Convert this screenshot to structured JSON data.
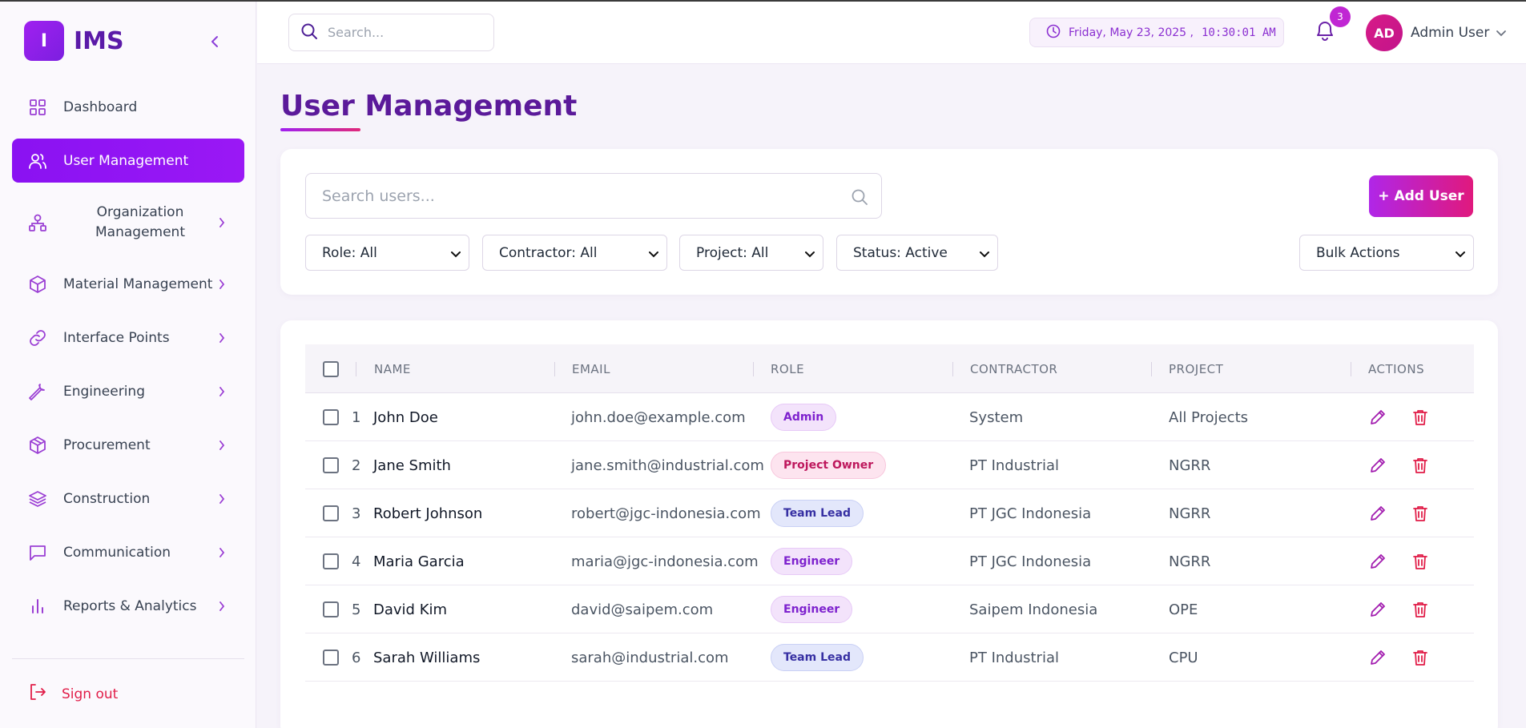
{
  "app": {
    "logo_letter": "I",
    "logo_text": "IMS"
  },
  "sidebar": {
    "items": [
      {
        "label": "Dashboard",
        "icon": "grid-icon",
        "active": false,
        "has_chevron": false
      },
      {
        "label": "User Management",
        "icon": "users-icon",
        "active": true,
        "has_chevron": false
      },
      {
        "label": "Organization Management",
        "icon": "org-chart-icon",
        "active": false,
        "has_chevron": true
      },
      {
        "label": "Material Management",
        "icon": "box-icon",
        "active": false,
        "has_chevron": true
      },
      {
        "label": "Interface Points",
        "icon": "link-icon",
        "active": false,
        "has_chevron": true
      },
      {
        "label": "Engineering",
        "icon": "wrench-icon",
        "active": false,
        "has_chevron": true
      },
      {
        "label": "Procurement",
        "icon": "package-icon",
        "active": false,
        "has_chevron": true
      },
      {
        "label": "Construction",
        "icon": "layers-icon",
        "active": false,
        "has_chevron": true
      },
      {
        "label": "Communication",
        "icon": "chat-icon",
        "active": false,
        "has_chevron": true
      },
      {
        "label": "Reports & Analytics",
        "icon": "bar-chart-icon",
        "active": false,
        "has_chevron": true
      }
    ],
    "signout_label": "Sign out"
  },
  "header": {
    "search_placeholder": "Search...",
    "date": "Friday, May 23, 2025 ,",
    "time": "10:30:01 AM",
    "notification_count": "3",
    "avatar_initials": "AD",
    "user_name": "Admin User"
  },
  "main": {
    "title": "User Management",
    "search_placeholder": "Search users...",
    "add_button_label": "+ Add User",
    "filters": {
      "role": "Role: All",
      "contractor": "Contractor: All",
      "project": "Project: All",
      "status": "Status: Active",
      "bulk": "Bulk Actions"
    }
  },
  "table": {
    "headers": {
      "name": "NAME",
      "email": "EMAIL",
      "role": "ROLE",
      "contractor": "CONTRACTOR",
      "project": "PROJECT",
      "actions": "ACTIONS"
    },
    "rows": [
      {
        "no": "1",
        "name": "John Doe",
        "email": "john.doe@example.com",
        "role": "Admin",
        "contractor": "System",
        "project": "All Projects"
      },
      {
        "no": "2",
        "name": "Jane Smith",
        "email": "jane.smith@industrial.com",
        "role": "Project Owner",
        "contractor": "PT Industrial",
        "project": "NGRR"
      },
      {
        "no": "3",
        "name": "Robert Johnson",
        "email": "robert@jgc-indonesia.com",
        "role": "Team Lead",
        "contractor": "PT JGC Indonesia",
        "project": "NGRR"
      },
      {
        "no": "4",
        "name": "Maria Garcia",
        "email": "maria@jgc-indonesia.com",
        "role": "Engineer",
        "contractor": "PT JGC Indonesia",
        "project": "NGRR"
      },
      {
        "no": "5",
        "name": "David Kim",
        "email": "david@saipem.com",
        "role": "Engineer",
        "contractor": "Saipem Indonesia",
        "project": "OPE"
      },
      {
        "no": "6",
        "name": "Sarah Williams",
        "email": "sarah@industrial.com",
        "role": "Team Lead",
        "contractor": "PT Industrial",
        "project": "CPU"
      }
    ]
  },
  "colors": {
    "accent": "#8a12f2",
    "pill_admin_bg": "#f3e3fb",
    "pill_admin_fg": "#7e22ce",
    "pill_owner_bg": "#fde4ef",
    "pill_owner_fg": "#be185d",
    "pill_lead_bg": "#e3e7fb",
    "pill_lead_fg": "#3730a3",
    "pill_engineer_bg": "#f3e3fb",
    "pill_engineer_fg": "#7e22ce",
    "delete": "#e11d48"
  }
}
